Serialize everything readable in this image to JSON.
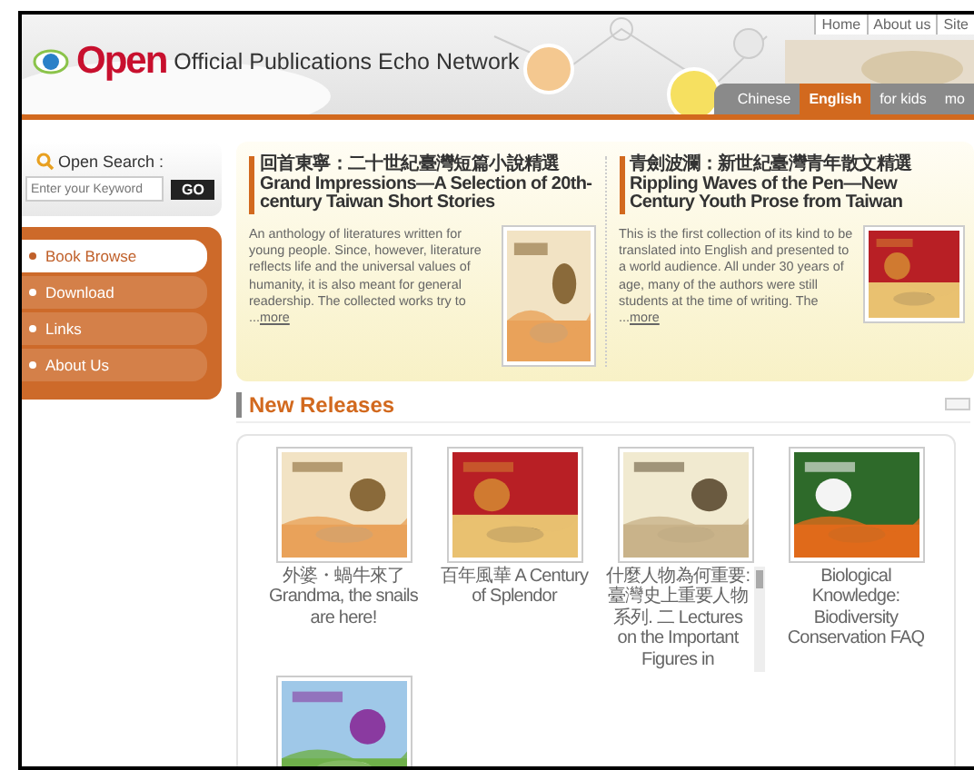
{
  "header": {
    "logo": "Open",
    "site_title": "Official Publications Echo Network",
    "top_links": [
      "Home",
      "About us",
      "Site"
    ],
    "language_tabs": [
      {
        "label": "Chinese",
        "selected": false
      },
      {
        "label": "English",
        "selected": true
      },
      {
        "label": "for kids",
        "selected": false
      },
      {
        "label": "mo",
        "selected": false
      }
    ]
  },
  "search": {
    "label": "Open Search :",
    "placeholder": "Enter your Keyword",
    "button": "GO"
  },
  "menu": [
    {
      "label": "Book Browse",
      "selected": true
    },
    {
      "label": "Download",
      "selected": false
    },
    {
      "label": "Links",
      "selected": false
    },
    {
      "label": "About Us",
      "selected": false
    }
  ],
  "features": [
    {
      "title": "回首東寧：二十世紀臺灣短篇小說精選Grand Impressions—A Selection of 20th-century Taiwan Short Stories",
      "body": "An anthology of literatures written for young people. Since, however, literature reflects life and the universal values of humanity, it is also meant for general readership. The collected works try to ...",
      "more": "more"
    },
    {
      "title": "青劍波瀾：新世紀臺灣青年散文精選Rippling Waves of the Pen—New Century Youth Prose from Taiwan",
      "body": "This is the first collection of its kind to be translated into English and presented to a world audience. All under 30 years of age, many of the authors were still students at the time of writing. The ...",
      "more": "more"
    }
  ],
  "new_releases": {
    "title": "New Releases",
    "books": [
      {
        "caption": "外婆・蝸牛來了 Grandma, the snails are here!",
        "scrollable": false
      },
      {
        "caption": "百年風華 A Century of Splendor",
        "scrollable": false
      },
      {
        "caption": "什麼人物為何重要:臺灣史上重要人物系列. 二 Lectures on the Important Figures in",
        "scrollable": true
      },
      {
        "caption": "Biological Knowledge: Biodiversity Conservation FAQ",
        "scrollable": false
      },
      {
        "kind": "picture"
      }
    ]
  }
}
